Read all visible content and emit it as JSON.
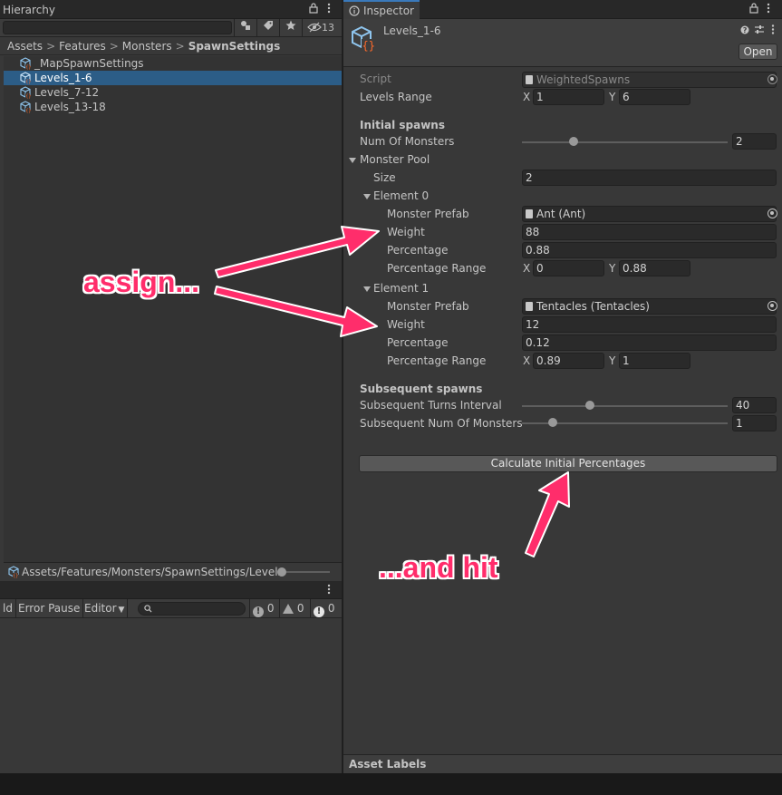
{
  "hierarchy_tab": {
    "title": "Hierarchy",
    "hidden_count": "13"
  },
  "breadcrumb": [
    "Assets",
    "Features",
    "Monsters",
    "SpawnSettings"
  ],
  "files": [
    {
      "label": "_MapSpawnSettings",
      "selected": false
    },
    {
      "label": "Levels_1-6",
      "selected": true
    },
    {
      "label": "Levels_7-12",
      "selected": false
    },
    {
      "label": "Levels_13-18",
      "selected": false
    }
  ],
  "path_bar": "Assets/Features/Monsters/SpawnSettings/Levels_",
  "console_toolbar": {
    "clear_partial": "ld",
    "error_pause": "Error Pause",
    "editor": "Editor",
    "info_count": "0",
    "warning_count": "0",
    "error_count": "0"
  },
  "inspector": {
    "tab_title": "Inspector",
    "asset_name": "Levels_1-6",
    "open_label": "Open",
    "script_label": "Script",
    "script_value": "WeightedSpawns",
    "levels_range_label": "Levels Range",
    "levels_range_x": "1",
    "levels_range_y": "6",
    "initial_spawns_header": "Initial spawns",
    "num_monsters_label": "Num Of Monsters",
    "num_monsters_value": "2",
    "num_monsters_fraction": 0.25,
    "monster_pool_label": "Monster Pool",
    "size_label": "Size",
    "size_value": "2",
    "elements": [
      {
        "label": "Element 0",
        "prefab_label": "Monster Prefab",
        "prefab_value": "Ant (Ant)",
        "weight_label": "Weight",
        "weight_value": "88",
        "percentage_label": "Percentage",
        "percentage_value": "0.88",
        "range_label": "Percentage Range",
        "range_x": "0",
        "range_y": "0.88"
      },
      {
        "label": "Element 1",
        "prefab_label": "Monster Prefab",
        "prefab_value": "Tentacles (Tentacles)",
        "weight_label": "Weight",
        "weight_value": "12",
        "percentage_label": "Percentage",
        "percentage_value": "0.12",
        "range_label": "Percentage Range",
        "range_x": "0.89",
        "range_y": "1"
      }
    ],
    "subsequent_header": "Subsequent spawns",
    "turns_interval_label": "Subsequent Turns Interval",
    "turns_interval_value": "40",
    "turns_interval_fraction": 0.33,
    "sub_num_label": "Subsequent Num Of Monsters",
    "sub_num_value": "1",
    "sub_num_fraction": 0.15,
    "calc_button": "Calculate Initial Percentages",
    "asset_labels": "Asset Labels"
  },
  "annotations": {
    "assign": "assign...",
    "hit": "...and hit",
    "color": "#ff2d6b"
  },
  "colors": {
    "selection": "#2c5d87",
    "accent": "#3a79bb",
    "panel": "#383838"
  }
}
